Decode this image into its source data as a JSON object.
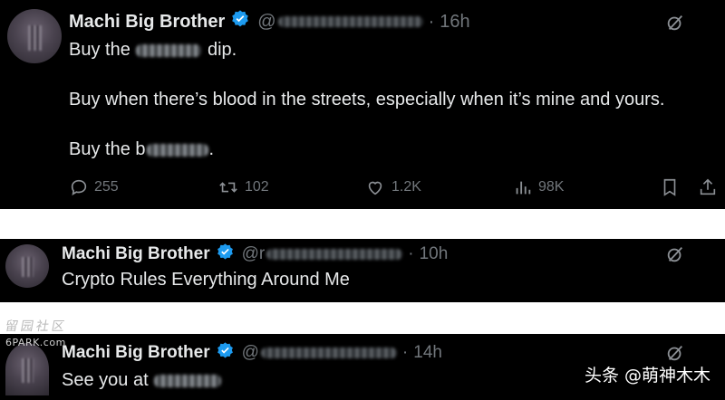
{
  "tweets": [
    {
      "name": "Machi Big Brother",
      "handle": "@",
      "time": "16h",
      "lines": {
        "l1a": "Buy the",
        "l1b": "dip.",
        "l2": "Buy when there’s blood in the streets, especially when it’s mine and yours.",
        "l3a": "Buy the b",
        "l3b": "."
      },
      "stats": {
        "replies": "255",
        "reposts": "102",
        "likes": "1.2K",
        "views": "98K"
      }
    },
    {
      "name": "Machi Big Brother",
      "handle": "@r",
      "time": "10h",
      "text": "Crypto Rules Everything Around Me"
    },
    {
      "name": "Machi Big Brother",
      "handle": "@",
      "time": "14h",
      "text": "See you at"
    }
  ],
  "watermarks": {
    "left_glyphs": "留园社区",
    "left_site": "6PARK.com",
    "right": "头条 @萌神木木"
  },
  "icons": [
    "verified-badge-icon",
    "grok-icon",
    "reply-icon",
    "repost-icon",
    "like-icon",
    "views-icon",
    "bookmark-icon",
    "share-icon"
  ],
  "colors": {
    "background": "#000000",
    "text": "#e7e9ea",
    "muted": "#71767b",
    "verified": "#1d9bf0"
  }
}
